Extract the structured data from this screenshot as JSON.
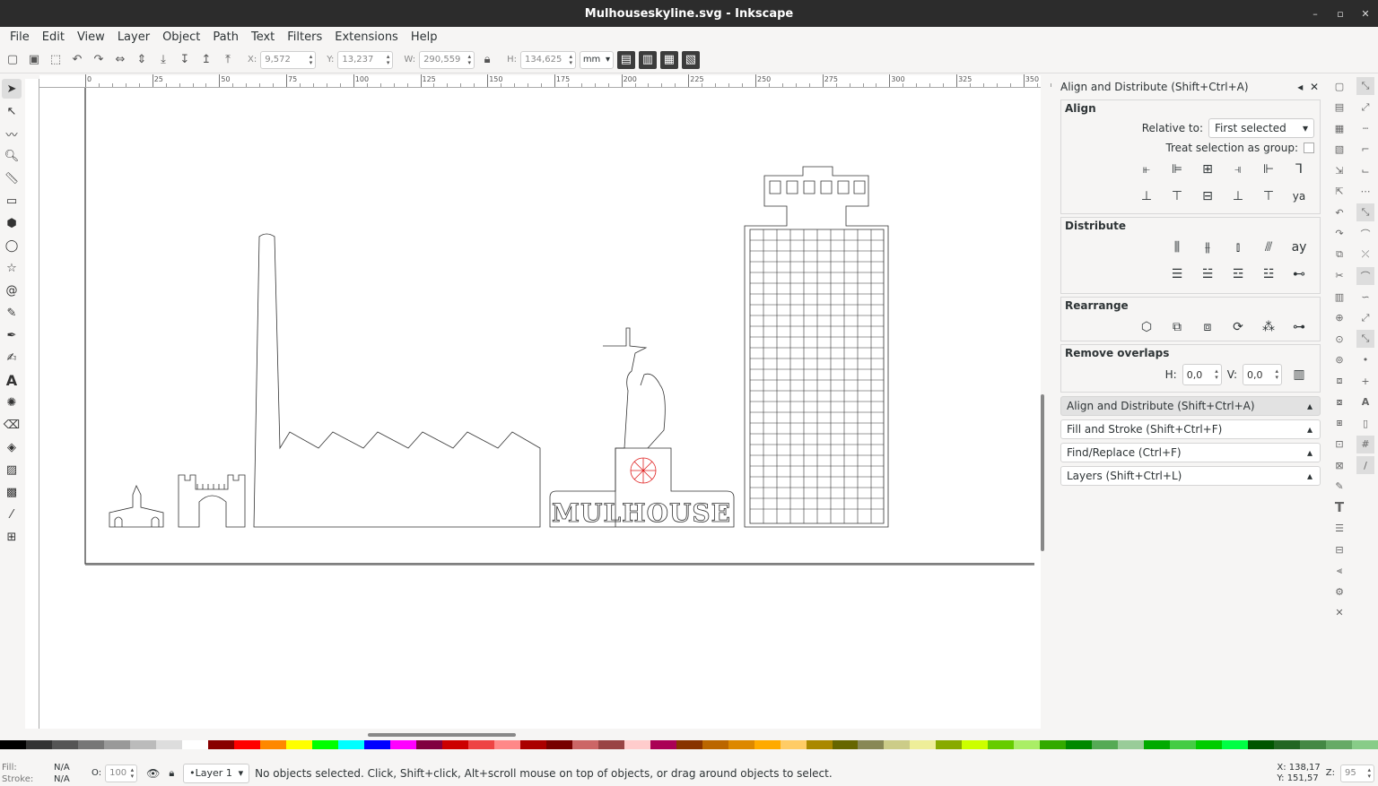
{
  "window": {
    "title": "Mulhouseskyline.svg - Inkscape",
    "controls": [
      "–",
      "▫",
      "✕"
    ]
  },
  "menu": [
    "File",
    "Edit",
    "View",
    "Layer",
    "Object",
    "Path",
    "Text",
    "Filters",
    "Extensions",
    "Help"
  ],
  "toolbar": {
    "x_label": "X:",
    "x": "9,572",
    "y_label": "Y:",
    "y": "13,237",
    "w_label": "W:",
    "w": "290,559",
    "h_label": "H:",
    "h": "134,625",
    "unit": "mm"
  },
  "ruler": {
    "ticks": [
      "0",
      "25",
      "50",
      "75",
      "100",
      "125",
      "150",
      "175",
      "200",
      "225",
      "250",
      "275",
      "300",
      "325",
      "350"
    ]
  },
  "canvas": {
    "logo_text": "MULHOUSE"
  },
  "panel": {
    "title": "Align and Distribute (Shift+Ctrl+A)",
    "align": {
      "heading": "Align",
      "relative_label": "Relative to:",
      "relative_value": "First selected",
      "group_label": "Treat selection as group:"
    },
    "distribute": {
      "heading": "Distribute"
    },
    "rearrange": {
      "heading": "Rearrange"
    },
    "overlaps": {
      "heading": "Remove overlaps",
      "h_label": "H:",
      "h": "0,0",
      "v_label": "V:",
      "v": "0,0"
    },
    "docks": [
      "Align and Distribute (Shift+Ctrl+A)",
      "Fill and Stroke (Shift+Ctrl+F)",
      "Find/Replace (Ctrl+F)",
      "Layers (Shift+Ctrl+L)"
    ]
  },
  "status": {
    "fill_label": "Fill:",
    "fill": "N/A",
    "stroke_label": "Stroke:",
    "stroke": "N/A",
    "opacity_label": "O:",
    "opacity": "100",
    "layer": "•Layer 1",
    "message": "No objects selected. Click, Shift+click, Alt+scroll mouse on top of objects, or drag around objects to select.",
    "x_label": "X:",
    "x": "138,17",
    "y_label": "Y:",
    "y": "151,57",
    "zoom_label": "Z:",
    "zoom": "95"
  },
  "colors": {
    "titlebar": "#2c2c2c",
    "accent_red": "#e02020",
    "page_border": "#333333"
  }
}
